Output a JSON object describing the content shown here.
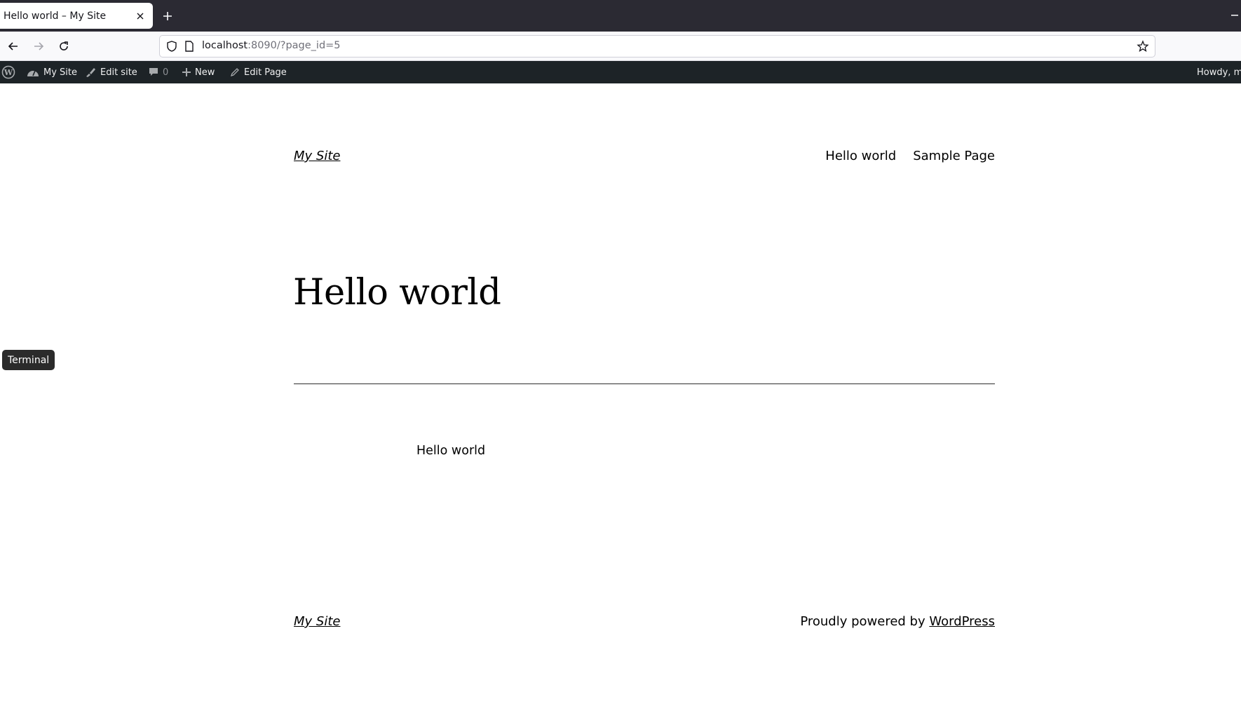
{
  "browser": {
    "tab_title": "Hello world – My Site",
    "url_host": "localhost",
    "url_rest": ":8090/?page_id=5"
  },
  "admin_bar": {
    "site_label": "My Site",
    "edit_site_label": "Edit site",
    "comments_count": "0",
    "new_label": "New",
    "edit_page_label": "Edit Page",
    "howdy_label": "Howdy, ma"
  },
  "header": {
    "site_title": "My Site",
    "nav": [
      "Hello world",
      "Sample Page"
    ]
  },
  "main": {
    "title": "Hello world",
    "paragraph": "Hello world"
  },
  "footer": {
    "site_title": "My Site",
    "powered_prefix": "Proudly powered by ",
    "powered_link": "WordPress"
  },
  "tooltip": {
    "label": "Terminal"
  },
  "colors": {
    "tabbar": "#2b2a33",
    "adminbar": "#1d2327",
    "page_bg": "#ffffff"
  }
}
